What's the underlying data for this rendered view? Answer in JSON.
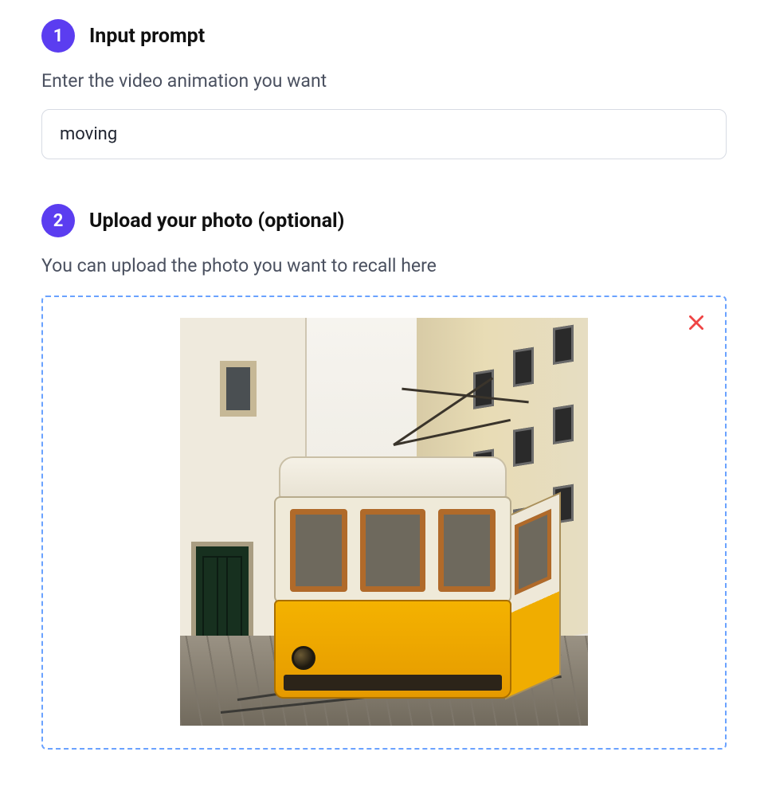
{
  "step1": {
    "number": "1",
    "title": "Input prompt",
    "description": "Enter the video animation you want",
    "value": "moving"
  },
  "step2": {
    "number": "2",
    "title": "Upload your photo (optional)",
    "description": "You can upload the photo you want to recall here",
    "uploaded_alt": "Yellow vintage tram on a narrow European street"
  },
  "icons": {
    "remove": "close-icon"
  },
  "colors": {
    "accent": "#5b3df0",
    "dropzone_border": "#6aa2ff",
    "danger": "#ef4444"
  }
}
